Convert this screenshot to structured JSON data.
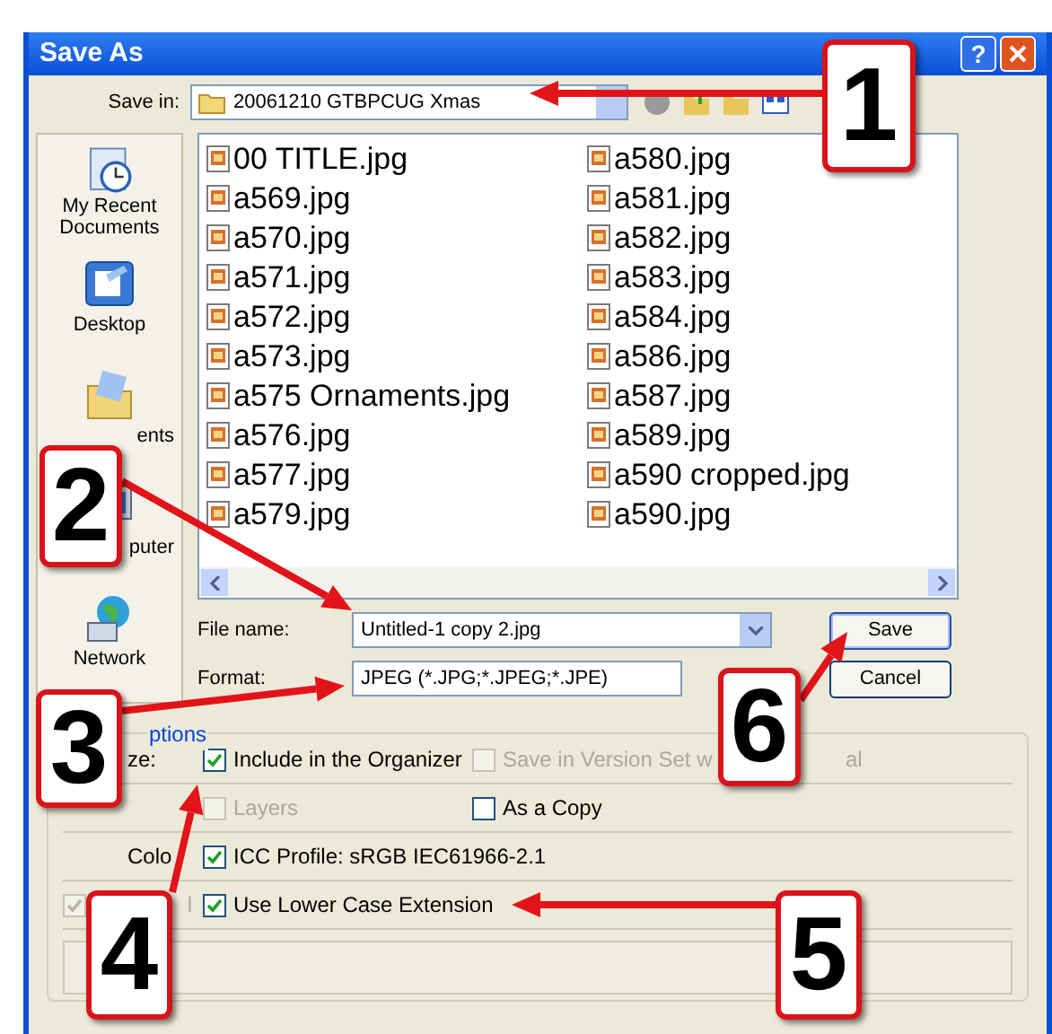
{
  "window": {
    "title": "Save As",
    "help": "?"
  },
  "save_in": {
    "label": "Save in:",
    "value": "20061210 GTBPCUG Xmas"
  },
  "places": [
    {
      "kind": "recent",
      "label": "My Recent Documents"
    },
    {
      "kind": "desktop",
      "label": "Desktop"
    },
    {
      "kind": "documents",
      "label": "ents"
    },
    {
      "kind": "computer",
      "label": "puter"
    },
    {
      "kind": "network",
      "label": "Network"
    }
  ],
  "files": [
    "00 TITLE.jpg",
    "a569.jpg",
    "a570.jpg",
    "a571.jpg",
    "a572.jpg",
    "a573.jpg",
    "a575 Ornaments.jpg",
    "a576.jpg",
    "a577.jpg",
    "a579.jpg",
    "a580.jpg",
    "a581.jpg",
    "a582.jpg",
    "a583.jpg",
    "a584.jpg",
    "a586.jpg",
    "a587.jpg",
    "a589.jpg",
    "a590 cropped.jpg",
    "a590.jpg"
  ],
  "file_name": {
    "label": "File name:",
    "value": "Untitled-1 copy 2.jpg"
  },
  "format": {
    "label": "Format:",
    "value": "JPEG (*.JPG;*.JPEG;*.JPE)"
  },
  "buttons": [
    {
      "label": "Save",
      "default": true
    },
    {
      "label": "Cancel",
      "default": false
    }
  ],
  "options": {
    "legend": "ptions",
    "rows": [
      {
        "label": "ze:",
        "items": [
          {
            "kind": "checkbox",
            "label": "Include in the Organizer",
            "checked": true,
            "disabled": false
          },
          {
            "kind": "checkbox",
            "label": "Save in Version Set w",
            "checked": false,
            "disabled": true
          },
          {
            "kind": "text",
            "label": "al",
            "disabled": true
          }
        ]
      },
      {
        "items": [
          {
            "kind": "checkbox",
            "label": "Layers",
            "checked": false,
            "disabled": true
          },
          {
            "kind": "checkbox",
            "label": "As a Copy",
            "checked": false,
            "disabled": false
          }
        ]
      },
      {
        "label": "Colo",
        "items": [
          {
            "kind": "checkbox",
            "label": "ICC Profile:  sRGB IEC61966-2.1",
            "checked": true,
            "disabled": false
          }
        ]
      },
      {
        "items": [
          {
            "kind": "checkbox_partial",
            "label": "l",
            "checked": true,
            "disabled": true
          },
          {
            "kind": "checkbox",
            "label": "Use Lower Case Extension",
            "checked": true,
            "disabled": false
          }
        ]
      }
    ]
  },
  "callouts": [
    "1",
    "2",
    "3",
    "6",
    "4",
    "5"
  ]
}
